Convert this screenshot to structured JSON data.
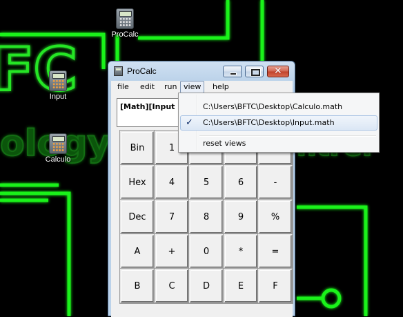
{
  "desktop": {
    "icons": [
      {
        "label": "ProCalc"
      },
      {
        "label": "Input"
      },
      {
        "label": "Calculo"
      }
    ]
  },
  "window": {
    "title": "ProCalc",
    "close_glyph": "✕"
  },
  "menubar": {
    "items": [
      "file",
      "edit",
      "run",
      "view",
      "help"
    ],
    "active": "view"
  },
  "display": {
    "text": "[Math][Input 2"
  },
  "keypad": {
    "rows": [
      [
        "Bin",
        "1",
        "",
        "",
        ""
      ],
      [
        "Hex",
        "4",
        "5",
        "6",
        "-"
      ],
      [
        "Dec",
        "7",
        "8",
        "9",
        "%"
      ],
      [
        "A",
        "+",
        "0",
        "*",
        "="
      ],
      [
        "B",
        "C",
        "D",
        "E",
        "F"
      ]
    ]
  },
  "view_menu": {
    "items": [
      {
        "label": "C:\\Users\\BFTC\\Desktop\\Calculo.math",
        "checked": false
      },
      {
        "label": "C:\\Users\\BFTC\\Desktop\\Input.math",
        "checked": true
      },
      {
        "label": "reset views",
        "checked": false
      }
    ],
    "check_glyph": "✓"
  },
  "colors": {
    "wallpaper_bg": "#000000",
    "neon_green": "#22ff22",
    "accent": "#0c2a66"
  }
}
